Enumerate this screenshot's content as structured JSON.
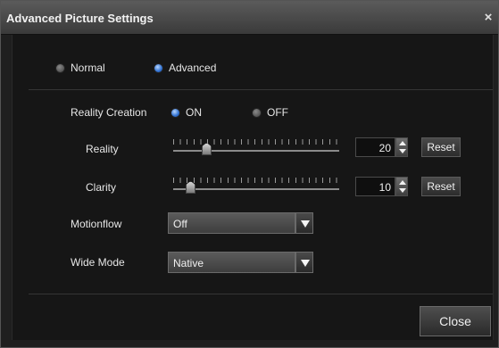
{
  "window": {
    "title": "Advanced Picture Settings",
    "close_glyph": "×"
  },
  "mode": {
    "options": [
      {
        "label": "Normal",
        "selected": false
      },
      {
        "label": "Advanced",
        "selected": true
      }
    ]
  },
  "reality_creation": {
    "label": "Reality Creation",
    "options": [
      {
        "label": "ON",
        "selected": true
      },
      {
        "label": "OFF",
        "selected": false
      }
    ]
  },
  "sliders": [
    {
      "label": "Reality",
      "value": "20",
      "fraction": 0.2,
      "reset_label": "Reset"
    },
    {
      "label": "Clarity",
      "value": "10",
      "fraction": 0.1,
      "reset_label": "Reset"
    }
  ],
  "motionflow": {
    "label": "Motionflow",
    "value": "Off"
  },
  "wide_mode": {
    "label": "Wide Mode",
    "value": "Native"
  },
  "footer": {
    "close_label": "Close"
  },
  "colors": {
    "accent": "#2e6fd0",
    "background": "#161616"
  }
}
